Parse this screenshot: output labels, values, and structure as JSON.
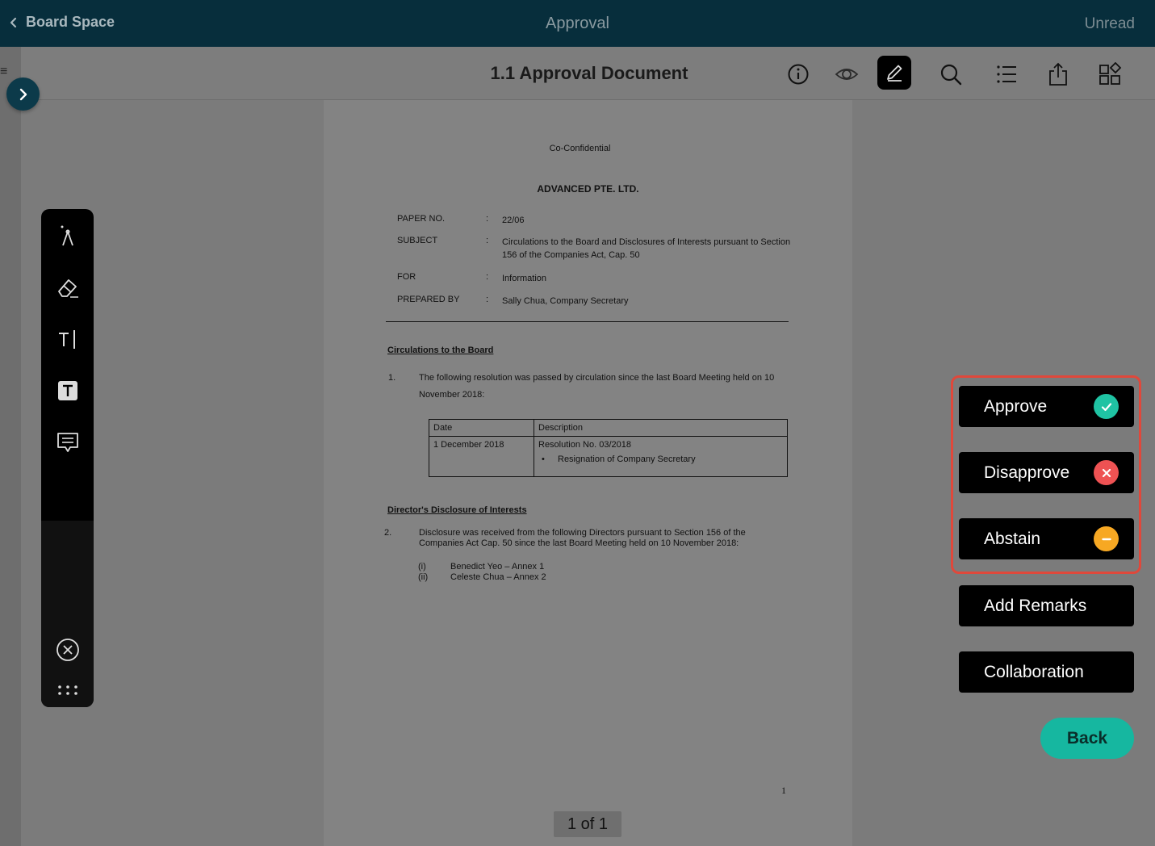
{
  "topbar": {
    "back_label": "Board Space",
    "title": "Approval",
    "unread_label": "Unread"
  },
  "toolbar": {
    "doc_title": "1.1 Approval Document",
    "icons": [
      "info-icon",
      "eye-icon",
      "pen-icon",
      "search-icon",
      "list-icon",
      "share-icon",
      "grid-icon"
    ]
  },
  "document": {
    "confidential": "Co-Confidential",
    "company": "ADVANCED PTE. LTD.",
    "meta": [
      {
        "key": "PAPER NO.",
        "sep": ":",
        "value": "22/06"
      },
      {
        "key": "SUBJECT",
        "sep": ":",
        "value": "Circulations to the Board and Disclosures of Interests pursuant to Section 156 of the Companies Act, Cap. 50"
      },
      {
        "key": "FOR",
        "sep": ":",
        "value": "Information"
      },
      {
        "key": "PREPARED BY",
        "sep": ":",
        "value": "Sally Chua, Company Secretary"
      }
    ],
    "section1_title": "Circulations to the Board",
    "para1_num": "1.",
    "para1_text": "The following resolution was passed by circulation since the last Board Meeting held on 10 November 2018:",
    "table": {
      "headers": [
        "Date",
        "Description"
      ],
      "row_date": "1 December 2018",
      "row_title": "Resolution No. 03/2018",
      "row_bullet": "Resignation of Company Secretary"
    },
    "section2_title": "Director's Disclosure of Interests",
    "para2_num": "2.",
    "para2_text": "Disclosure was received from the following Directors pursuant to Section 156 of the Companies Act Cap. 50 since the last Board Meeting held on 10 November 2018:",
    "annex": [
      {
        "roman": "(i)",
        "text": "Benedict Yeo – Annex 1"
      },
      {
        "roman": "(ii)",
        "text": "Celeste Chua – Annex 2"
      }
    ],
    "page_number": "1"
  },
  "pager": "1 of 1",
  "actions": {
    "approve": "Approve",
    "disapprove": "Disapprove",
    "abstain": "Abstain",
    "add_remarks": "Add Remarks",
    "collaboration": "Collaboration",
    "back": "Back"
  },
  "colors": {
    "topbar": "#072e3c",
    "approve": "#1fc3a3",
    "disapprove": "#ee5253",
    "abstain": "#f7a823",
    "back": "#16b7a0",
    "highlight_border": "#e0483b"
  }
}
